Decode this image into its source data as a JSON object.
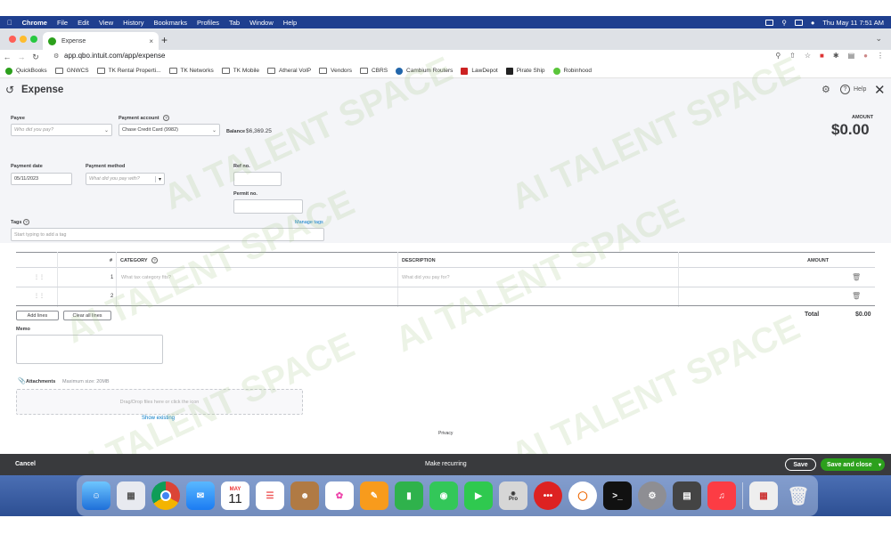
{
  "menubar": {
    "app": "Chrome",
    "items": [
      "File",
      "Edit",
      "View",
      "History",
      "Bookmarks",
      "Profiles",
      "Tab",
      "Window",
      "Help"
    ],
    "clock": "Thu May 11  7:51 AM"
  },
  "tab": {
    "title": "Expense",
    "close": "×",
    "new": "+"
  },
  "address": {
    "url": "app.qbo.intuit.com/app/expense"
  },
  "bookmarks": [
    "QuickBooks",
    "GNWCS",
    "TK Rental Properti...",
    "TK Networks",
    "TK Mobile",
    "Atheral VoIP",
    "Vendors",
    "CBRS",
    "Cambium Routers",
    "LawDepot",
    "Pirate Ship",
    "Robinhood"
  ],
  "header": {
    "title": "Expense",
    "help": "Help"
  },
  "form": {
    "payee_label": "Payee",
    "payee_placeholder": "Who did you pay?",
    "account_label": "Payment account",
    "account_value": "Chase Credit Card (9982)",
    "balance_label": "Balance",
    "balance_value": "$6,369.25",
    "amount_label": "AMOUNT",
    "amount_value": "$0.00",
    "date_label": "Payment date",
    "date_value": "05/11/2023",
    "method_label": "Payment method",
    "method_placeholder": "What did you pay with?",
    "ref_label": "Ref no.",
    "permit_label": "Permit no.",
    "tags_label": "Tags",
    "manage_tags": "Manage tags",
    "tags_placeholder": "Start typing to add a tag"
  },
  "table": {
    "col_num": "#",
    "col_category": "CATEGORY",
    "col_description": "DESCRIPTION",
    "col_amount": "AMOUNT",
    "rows": [
      {
        "num": "1",
        "category_placeholder": "What tax category fits?",
        "description_placeholder": "What did you pay for?"
      },
      {
        "num": "2",
        "category_placeholder": "",
        "description_placeholder": ""
      }
    ],
    "add_lines": "Add lines",
    "clear_lines": "Clear all lines",
    "total_label": "Total",
    "total_value": "$0.00"
  },
  "memo": {
    "label": "Memo"
  },
  "attachments": {
    "label": "Attachments",
    "max": "Maximum size: 20MB",
    "drop": "Drag/Drop files here or click the icon",
    "show_existing": "Show existing"
  },
  "privacy": "Privacy",
  "footer": {
    "cancel": "Cancel",
    "recurring": "Make recurring",
    "save": "Save",
    "save_close": "Save and close"
  },
  "dock": {
    "calendar_month": "MAY",
    "calendar_day": "11",
    "pro_badge": "Pro"
  },
  "watermark": "AI TALENT SPACE",
  "colors": {
    "accent": "#2ca01c",
    "link": "#0077c5",
    "menubar": "#1f3f8f",
    "footer": "#393a3d"
  }
}
